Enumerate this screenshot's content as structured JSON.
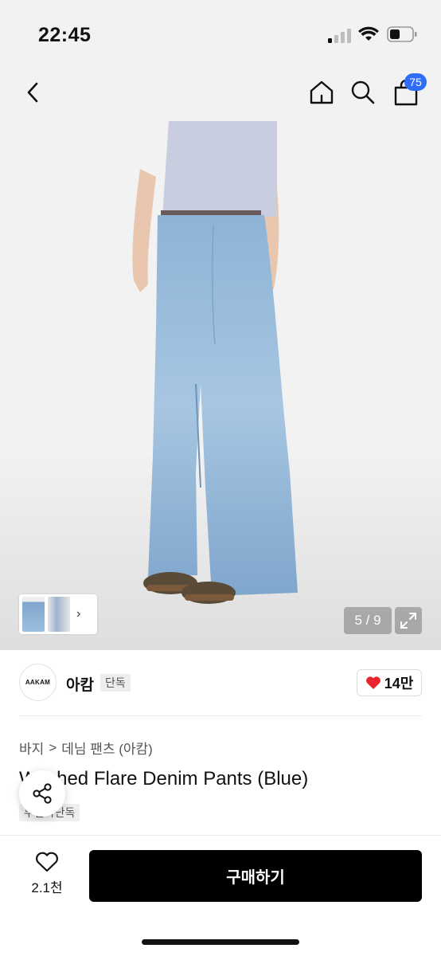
{
  "status_bar": {
    "time": "22:45"
  },
  "nav": {
    "back_icon": "chevron-left-icon",
    "home_icon": "home-icon",
    "search_icon": "search-icon",
    "cart_icon": "shopping-bag-icon",
    "cart_count": "75",
    "badge_color": "#2f6df6"
  },
  "gallery": {
    "page_counter": "5 / 9",
    "expand_icon": "expand-icon"
  },
  "brand": {
    "logo_text": "AAKAM",
    "name": "아캄",
    "badge": "단독",
    "like_count": "14만",
    "heart_color": "#e8242c"
  },
  "breadcrumb": {
    "category": "바지",
    "separator": ">",
    "subcategory": "데님 팬츠 (아캄)"
  },
  "product": {
    "title": "Washed Flare Denim Pants (Blue)",
    "badge": "무신사단독"
  },
  "bottom_bar": {
    "wish_count": "2.1천",
    "buy_label": "구매하기"
  }
}
